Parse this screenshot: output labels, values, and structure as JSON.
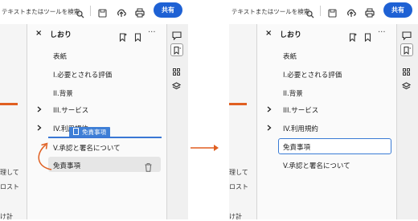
{
  "toolbar": {
    "search_label": "テキストまたはツールを検索",
    "share_label": "共有"
  },
  "bookmarks_panel": {
    "title": "しおり",
    "more_label": "···",
    "close_label": "×"
  },
  "before": {
    "items": [
      {
        "label": "表紙",
        "expand": false
      },
      {
        "label": "I.必要とされる評価",
        "expand": false
      },
      {
        "label": "II.背景",
        "expand": false
      },
      {
        "label": "III.サービス",
        "expand": true
      },
      {
        "label": "IV.利用規約",
        "expand": true
      },
      {
        "label": "V.承認と署名について",
        "expand": false
      },
      {
        "label": "免責事項",
        "expand": false
      }
    ],
    "drag_ghost_label": "免責事項"
  },
  "after": {
    "items": [
      {
        "label": "表紙",
        "expand": false
      },
      {
        "label": "I.必要とされる評価",
        "expand": false
      },
      {
        "label": "II.背景",
        "expand": false
      },
      {
        "label": "III.サービス",
        "expand": true
      },
      {
        "label": "IV.利用規約",
        "expand": true
      },
      {
        "label": "免責事項",
        "expand": false
      },
      {
        "label": "V.承認と署名について",
        "expand": false
      }
    ]
  },
  "doc_fragments": {
    "left_1": "理して",
    "left_2": "ロスト",
    "left_3": "け計",
    "mid_1": "理して",
    "mid_2": "ロスト",
    "mid_3": "け計"
  },
  "colors": {
    "accent_blue": "#1e61d4",
    "drag_blue": "#3f7fd6",
    "orange": "#e05f21"
  }
}
